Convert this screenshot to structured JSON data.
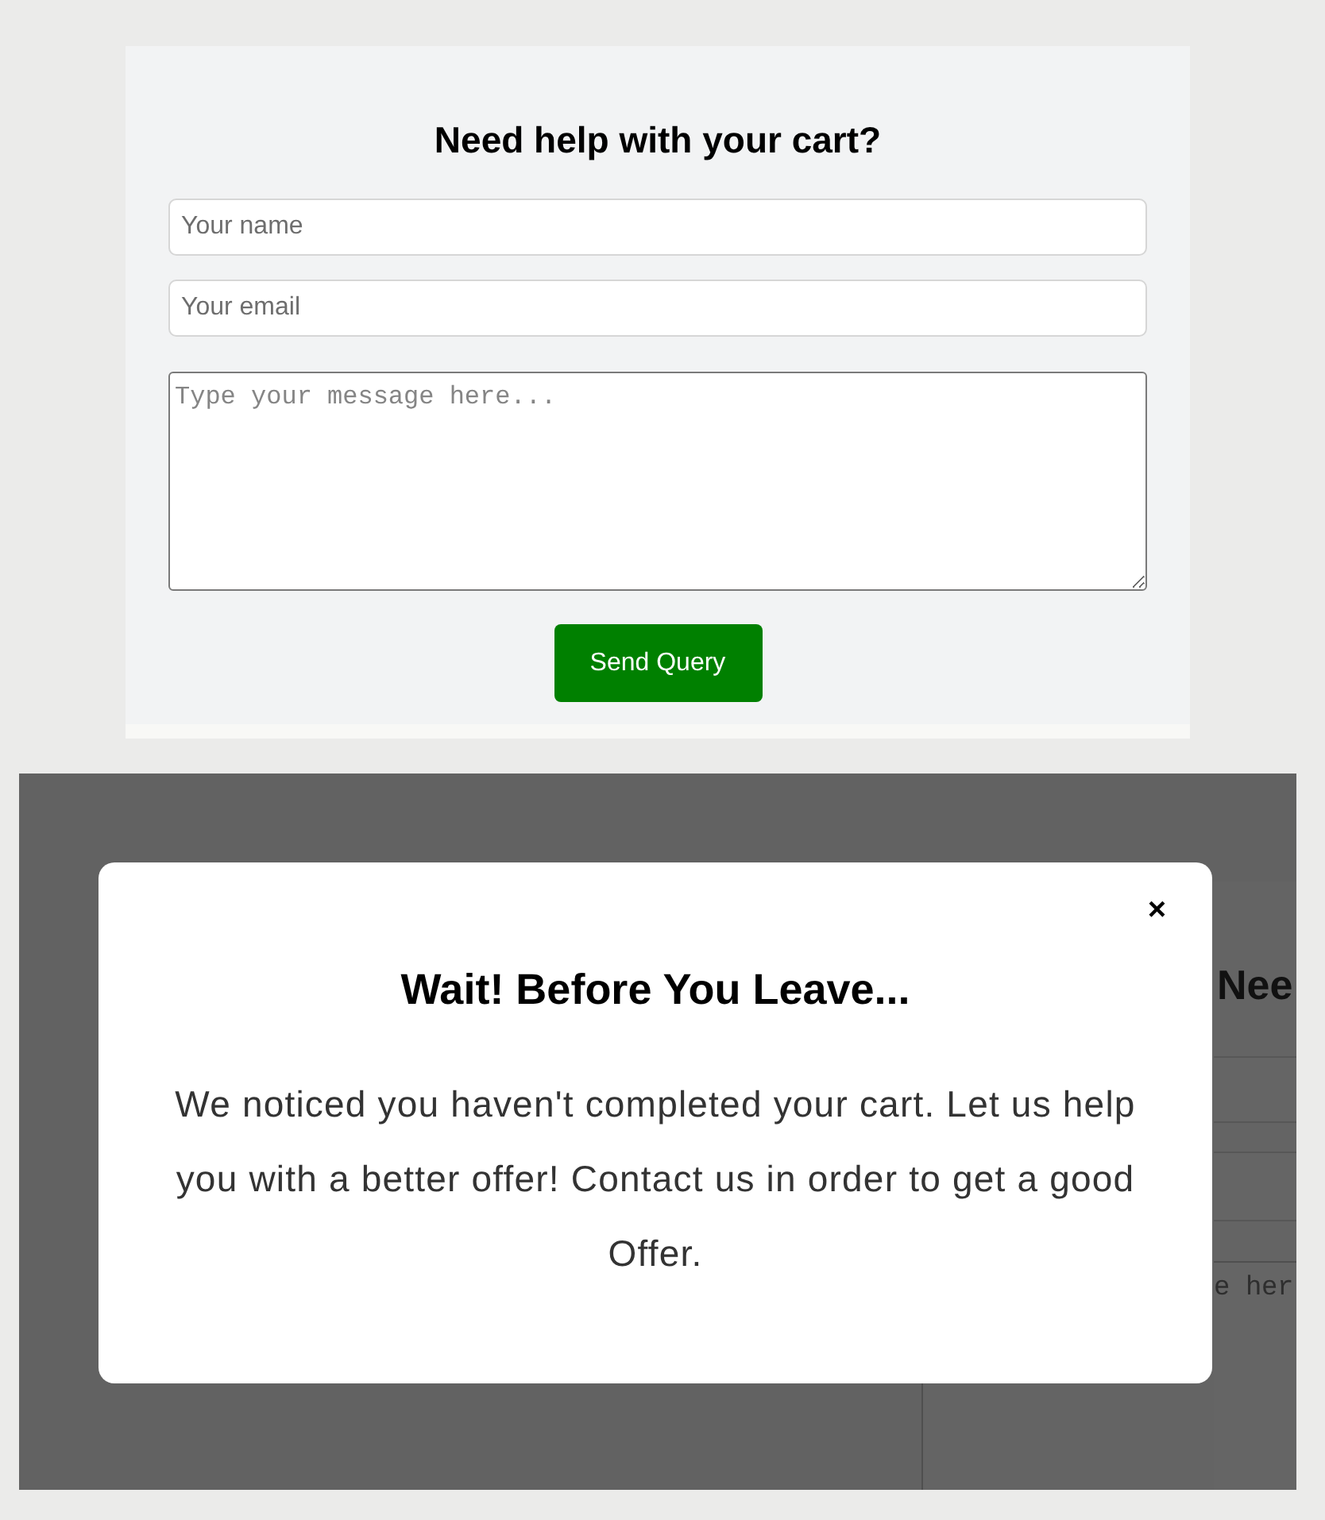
{
  "contact_card": {
    "title": "Need help with your cart?",
    "fields": [
      {
        "kind": "input",
        "placeholder": "Your name"
      },
      {
        "kind": "input",
        "placeholder": "Your email"
      },
      {
        "kind": "textarea",
        "placeholder": "Type your message here..."
      }
    ],
    "button": "Send Query"
  },
  "overlay": {
    "background_form": {
      "title": "Nee",
      "fields": [
        {
          "kind": "input"
        },
        {
          "kind": "input"
        },
        {
          "kind": "textarea",
          "placeholder": "e her"
        }
      ]
    },
    "modal": {
      "close": "×",
      "title": "Wait! Before You Leave...",
      "message": "We noticed you haven't completed your cart. Let us help you with a better offer! Contact us in order to get a good Offer."
    }
  }
}
